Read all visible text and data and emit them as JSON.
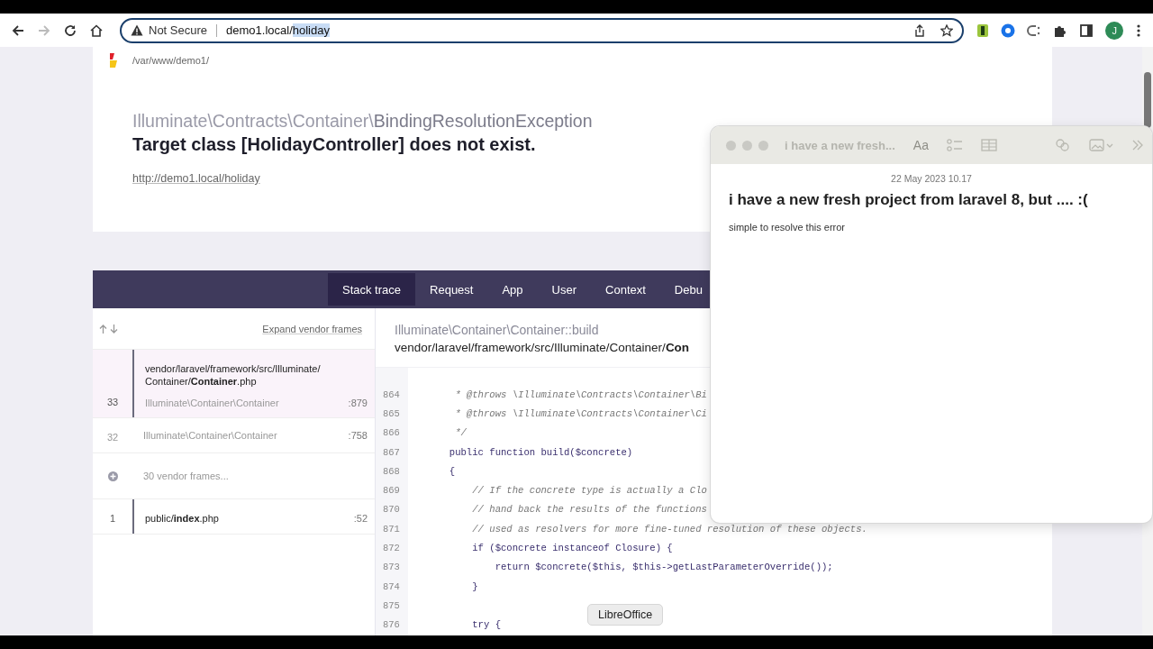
{
  "browser": {
    "security_label": "Not Secure",
    "url_host": "demo1.local/",
    "url_path": "holiday",
    "url_path_selected": true,
    "avatar_letter": "J"
  },
  "error_page": {
    "app_path": "/var/www/demo1/",
    "exception_namespace": "Illuminate\\Contracts\\Container\\",
    "exception_class": "BindingResolutionException",
    "message": "Target class [HolidayController] does not exist.",
    "url": "http://demo1.local/holiday",
    "tabs": [
      {
        "label": "Stack trace",
        "selected": true
      },
      {
        "label": "Request",
        "selected": false
      },
      {
        "label": "App",
        "selected": false
      },
      {
        "label": "User",
        "selected": false
      },
      {
        "label": "Context",
        "selected": false
      },
      {
        "label": "Debu",
        "selected": false
      }
    ],
    "expand_link": "Expand vendor frames",
    "frames": [
      {
        "kind": "app",
        "number": "33",
        "file": "vendor/laravel/framework/src/Illuminate/Container/**Container**.php",
        "class": "Illuminate\\Container\\Container",
        "line": ":879",
        "selected": true
      },
      {
        "kind": "vendor",
        "number": "32",
        "class": "Illuminate\\Container\\Container",
        "line": ":758",
        "selected": false
      },
      {
        "kind": "collapsed",
        "label": "30 vendor frames..."
      },
      {
        "kind": "app",
        "number": "1",
        "file": "public/**index**.php",
        "line": ":52",
        "selected": false
      }
    ],
    "code_header": {
      "method": "Illuminate\\Container\\Container::build",
      "file": "vendor/laravel/framework/src/Illuminate/Container/**Con**"
    },
    "code_lines": [
      {
        "number": "864",
        "kind": "comment",
        "text": "      * @throws \\Illuminate\\Contracts\\Container\\Bi"
      },
      {
        "number": "865",
        "kind": "comment",
        "text": "      * @throws \\Illuminate\\Contracts\\Container\\Ci"
      },
      {
        "number": "866",
        "kind": "comment",
        "text": "      */"
      },
      {
        "number": "867",
        "kind": "code",
        "text": "     public function build($concrete)"
      },
      {
        "number": "868",
        "kind": "code",
        "text": "     {"
      },
      {
        "number": "869",
        "kind": "comment",
        "text": "         // If the concrete type is actually a Clo"
      },
      {
        "number": "870",
        "kind": "comment",
        "text": "         // hand back the results of the functions"
      },
      {
        "number": "871",
        "kind": "comment",
        "text": "         // used as resolvers for more fine-tuned resolution of these objects."
      },
      {
        "number": "872",
        "kind": "code",
        "text": "         if ($concrete instanceof Closure) {"
      },
      {
        "number": "873",
        "kind": "code",
        "text": "             return $concrete($this, $this->getLastParameterOverride());"
      },
      {
        "number": "874",
        "kind": "code",
        "text": "         }"
      },
      {
        "number": "875",
        "kind": "code"
      },
      {
        "number": "876",
        "kind": "code",
        "text": "         try {"
      }
    ]
  },
  "notes_window": {
    "title": "i have a new fresh...",
    "format_label": "Aa",
    "date": "22 May 2023 10.17",
    "note_title": "i have a new fresh project from laravel 8, but .... :(",
    "note_body": "simple to resolve this error"
  },
  "dock_tooltip": "LibreOffice"
}
